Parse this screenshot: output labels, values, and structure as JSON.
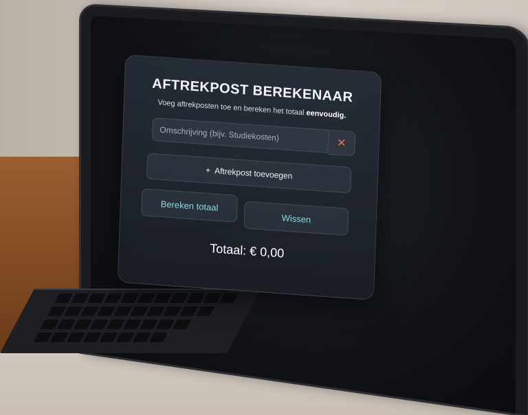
{
  "app": {
    "title": "AFTREKPOST BEREKENAAR",
    "subtitle_prefix": "Voeg aftrekposten toe en bereken het totaal",
    "subtitle_emphasis": "eenvoudig."
  },
  "entry": {
    "placeholder": "Omschrijving (bijv. Studiekosten)",
    "value": "",
    "remove_icon": "close-icon",
    "remove_label": "✕"
  },
  "actions": {
    "add_icon": "plus-icon",
    "add_symbol": "+",
    "add_label": "Aftrekpost toevoegen",
    "calculate_label": "Bereken totaal",
    "clear_label": "Wissen"
  },
  "total": {
    "label": "Totaal: € 0,00"
  },
  "colors": {
    "accent": "#8fd8e0",
    "remove": "#e6735a",
    "card_bg": "#1f252d"
  }
}
